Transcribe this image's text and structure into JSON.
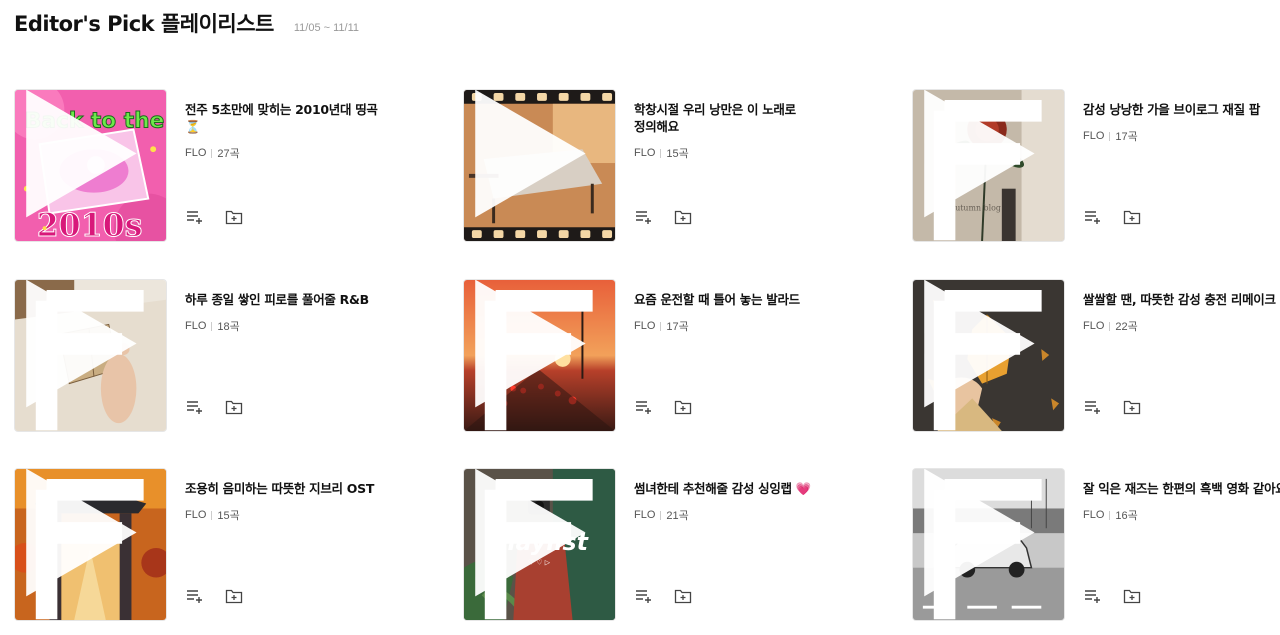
{
  "header": {
    "title": "Editor's Pick 플레이리스트",
    "date_range": "11/05 ~ 11/11"
  },
  "icons": {
    "play": "play-icon",
    "add_to_list": "playlist-add-icon",
    "save_folder": "folder-add-icon",
    "brand": "flo-logo-icon"
  },
  "playlists": [
    {
      "title": "전주 5초만에 맞히는 2010년대 띵곡 ⏳",
      "owner": "FLO",
      "count": "27곡",
      "cover_text": "Back to the 2010s",
      "cover_theme": "pink"
    },
    {
      "title": "학창시절 우리 낭만은 이 노래로 정의해요",
      "owner": "FLO",
      "count": "15곡",
      "cover_theme": "classroom"
    },
    {
      "title": "감성 낭낭한 가을 브이로그 재질 팝",
      "owner": "FLO",
      "count": "17곡",
      "cover_theme": "flower"
    },
    {
      "title": "하루 종일 쌓인 피로를 풀어줄 R&B",
      "owner": "FLO",
      "count": "18곡",
      "cover_theme": "bath"
    },
    {
      "title": "요즘 운전할 때 틀어 놓는 발라드",
      "owner": "FLO",
      "count": "17곡",
      "cover_theme": "sunset"
    },
    {
      "title": "쌀쌀할 땐, 따뜻한 감성 충전 리메이크",
      "owner": "FLO",
      "count": "22곡",
      "cover_theme": "leaves"
    },
    {
      "title": "조용히 음미하는 따뜻한 지브리 OST",
      "owner": "FLO",
      "count": "15곡",
      "cover_theme": "gate"
    },
    {
      "title": "썸녀한테 추천해줄 감성 싱잉랩 💗",
      "owner": "FLO",
      "count": "21곡",
      "cover_text": "Playlist",
      "cover_theme": "camera"
    },
    {
      "title": "잘 익은 재즈는 한편의 흑백 영화 같아요",
      "owner": "FLO",
      "count": "16곡",
      "cover_theme": "car"
    }
  ]
}
